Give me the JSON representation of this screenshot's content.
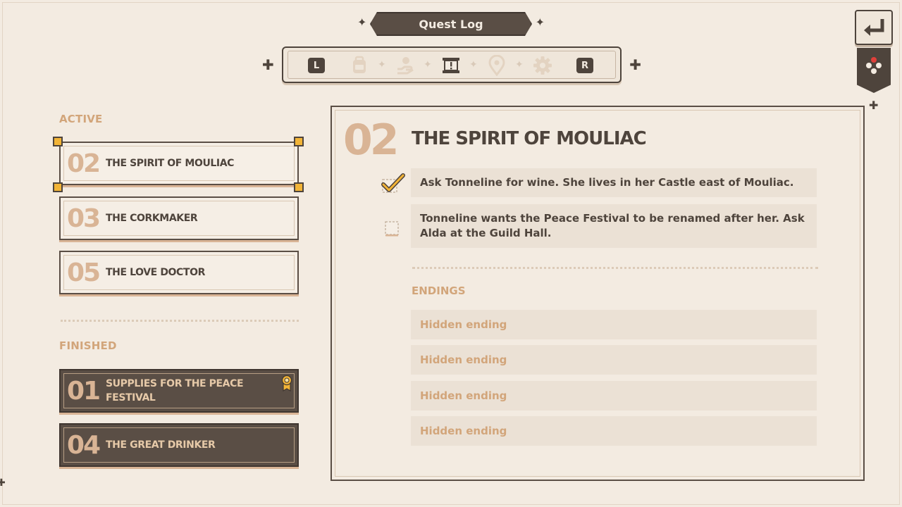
{
  "header": {
    "title": "Quest Log"
  },
  "tabs": {
    "left_key": "L",
    "right_key": "R",
    "items": [
      {
        "icon": "backpack-icon",
        "active": false
      },
      {
        "icon": "hand-coin-icon",
        "active": false
      },
      {
        "icon": "quest-scroll-icon",
        "active": true
      },
      {
        "icon": "map-pin-icon",
        "active": false
      },
      {
        "icon": "gear-icon",
        "active": false
      }
    ]
  },
  "sidebar": {
    "active_heading": "ACTIVE",
    "finished_heading": "FINISHED",
    "active_quests": [
      {
        "number": "02",
        "title": "THE SPIRIT OF MOULIAC",
        "selected": true
      },
      {
        "number": "03",
        "title": "THE CORKMAKER",
        "selected": false
      },
      {
        "number": "05",
        "title": "THE LOVE DOCTOR",
        "selected": false
      }
    ],
    "finished_quests": [
      {
        "number": "01",
        "title": "SUPPLIES FOR THE PEACE FESTIVAL",
        "ribbon": true
      },
      {
        "number": "04",
        "title": "THE GREAT DRINKER",
        "ribbon": false
      }
    ]
  },
  "detail": {
    "number": "02",
    "title": "THE SPIRIT OF MOULIAC",
    "objectives": [
      {
        "text": "Ask Tonneline for wine. She lives in her Castle east of Mouliac.",
        "done": true
      },
      {
        "text": "Tonneline wants the Peace Festival to be renamed after her. Ask Alda at the Guild Hall.",
        "done": false
      }
    ],
    "endings_heading": "ENDINGS",
    "endings": [
      "Hidden ending",
      "Hidden ending",
      "Hidden ending",
      "Hidden ending"
    ]
  },
  "colors": {
    "background": "#f3ebe1",
    "dark": "#4e443c",
    "accent": "#d9b495",
    "gold": "#f2b437"
  }
}
